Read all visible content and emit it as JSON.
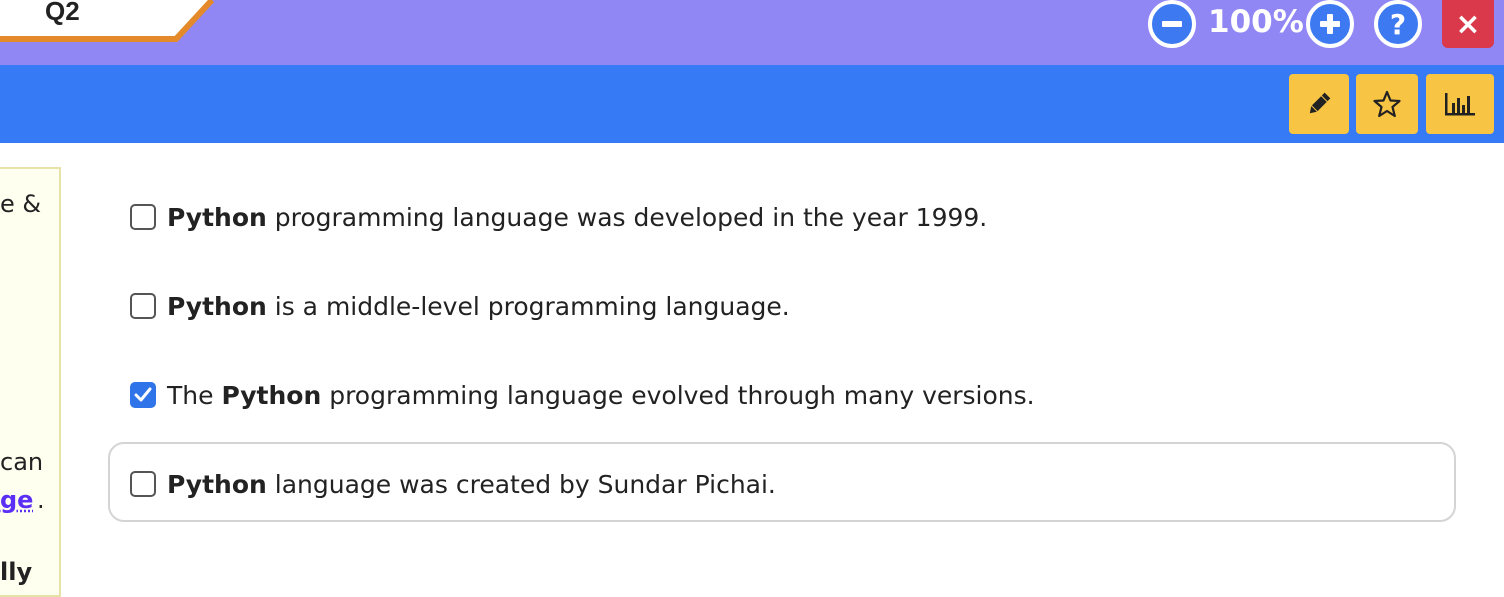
{
  "header": {
    "question_tab": "Q2",
    "zoom_level": "100%",
    "help_label": "?",
    "close_label": "×"
  },
  "toolbar": {
    "buttons": [
      "pencil-icon",
      "star-icon",
      "bar-chart-icon"
    ]
  },
  "side_panel": {
    "line1": "e &",
    "line2": "can",
    "link_text": "ge",
    "link_suffix": ".",
    "line3": "lly"
  },
  "options": [
    {
      "pre": "",
      "bold": "Python",
      "post": " programming language was developed in the year 1999.",
      "checked": false
    },
    {
      "pre": "",
      "bold": "Python",
      "post": " is a middle-level programming language.",
      "checked": false
    },
    {
      "pre": "The ",
      "bold": "Python",
      "post": " programming language evolved through many versions.",
      "checked": true
    },
    {
      "pre": "",
      "bold": "Python",
      "post": " language was created by Sundar Pichai.",
      "checked": false
    }
  ],
  "colors": {
    "topbar": "#9087f5",
    "toolbar": "#377af6",
    "tool_button": "#f7c443",
    "close": "#d9394b",
    "tab_accent": "#e48a2b",
    "checked": "#2f74e8"
  }
}
